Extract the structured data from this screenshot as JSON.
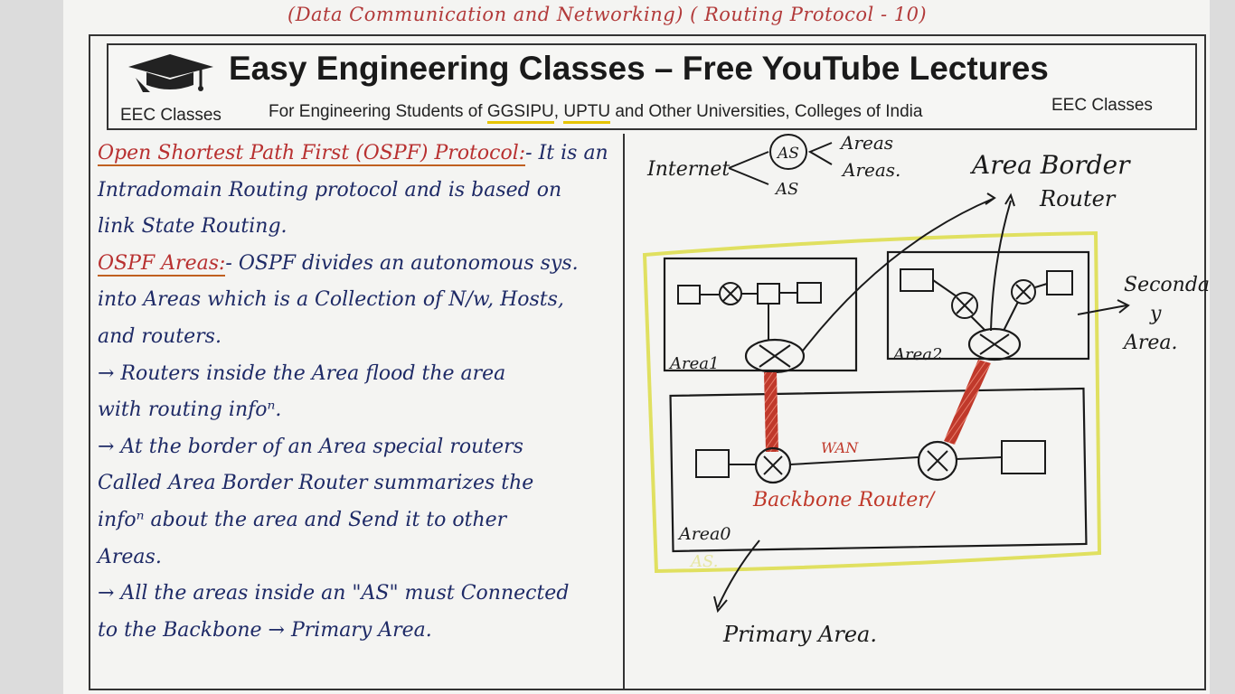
{
  "top_caption": "(Data Communication and Networking) ( Routing Protocol - 10)",
  "header": {
    "title": "Easy Engineering Classes – Free YouTube Lectures",
    "left_tag": "EEC Classes",
    "subtitle_prefix": "For Engineering Students of ",
    "subtitle_ggsipu": "GGSIPU",
    "subtitle_sep": ", ",
    "subtitle_uptu": "UPTU",
    "subtitle_suffix": " and Other Universities, Colleges of India",
    "right_tag": "EEC Classes",
    "highlight_color": "#e6c400"
  },
  "notes": {
    "l1_term": "Open Shortest Path First (OSPF) Protocol:",
    "l1_rest": "- It is an",
    "l2": "Intradomain Routing protocol and is based on",
    "l3": "link State Routing.",
    "l4_term": "OSPF Areas:",
    "l4_rest": "- OSPF divides an autonomous sys.",
    "l5": "into Areas which is a Collection of N/w, Hosts,",
    "l6": "and routers.",
    "l7": "→ Routers inside the Area flood the area",
    "l8": "with routing infoⁿ.",
    "l9": "→ At the border of an Area special routers",
    "l10": "Called Area Border Router summarizes the",
    "l11": "infoⁿ about the area and Send it to other",
    "l12": "Areas.",
    "l13": "→ All the areas inside an \"AS\" must Connected",
    "l14": "to the Backbone → Primary Area."
  },
  "diagram": {
    "internet": "Internet",
    "as_circle": "AS",
    "as_below": "AS",
    "areas_1": "Areas",
    "areas_2": "Areas.",
    "abr_1": "Area Border",
    "abr_2": "Router",
    "area1": "Area1",
    "area2": "Area2",
    "area0": "Area0",
    "as_faint": "AS.",
    "wan": "WAN",
    "backbone": "Backbone Router/",
    "secondary_1": "Seconda",
    "secondary_2": "y",
    "secondary_3": "Area.",
    "primary": "Primary Area.",
    "colors": {
      "ink": "#1a1a1a",
      "red": "#c0392b",
      "yellow": "#e0e060",
      "navy": "#1e2a66"
    }
  }
}
